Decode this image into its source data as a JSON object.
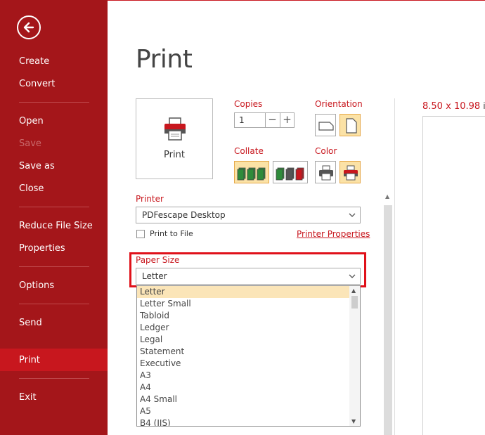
{
  "sidebar": {
    "items": [
      {
        "label": "Create"
      },
      {
        "label": "Convert"
      },
      {
        "label": "Open"
      },
      {
        "label": "Save"
      },
      {
        "label": "Save as"
      },
      {
        "label": "Close"
      },
      {
        "label": "Reduce File Size"
      },
      {
        "label": "Properties"
      },
      {
        "label": "Options"
      },
      {
        "label": "Send"
      },
      {
        "label": "Print"
      },
      {
        "label": "Exit"
      }
    ],
    "active": "Print",
    "disabled": [
      "Save"
    ]
  },
  "page": {
    "title": "Print"
  },
  "print_button": {
    "label": "Print"
  },
  "copies": {
    "label": "Copies",
    "value": "1",
    "minus": "−",
    "plus": "+"
  },
  "orientation": {
    "label": "Orientation",
    "selected": "portrait"
  },
  "collate": {
    "label": "Collate",
    "selected": "collated"
  },
  "color": {
    "label": "Color",
    "selected": "color"
  },
  "printer": {
    "label": "Printer",
    "value": "PDFescape Desktop"
  },
  "print_to_file": {
    "label": "Print to File",
    "checked": false
  },
  "printer_properties": {
    "label": "Printer Properties"
  },
  "paper_size": {
    "label": "Paper Size",
    "value": "Letter",
    "options": [
      "Letter",
      "Letter Small",
      "Tabloid",
      "Ledger",
      "Legal",
      "Statement",
      "Executive",
      "A3",
      "A4",
      "A4 Small",
      "A5",
      "B4 (JIS)"
    ],
    "highlighted": "Letter"
  },
  "preview": {
    "width": "8.50",
    "height": "10.98",
    "sep": "x",
    "unit": "in"
  },
  "colors": {
    "sidebar": "#a4161a",
    "accent": "#c8171e",
    "selection": "#fbe2a6"
  }
}
